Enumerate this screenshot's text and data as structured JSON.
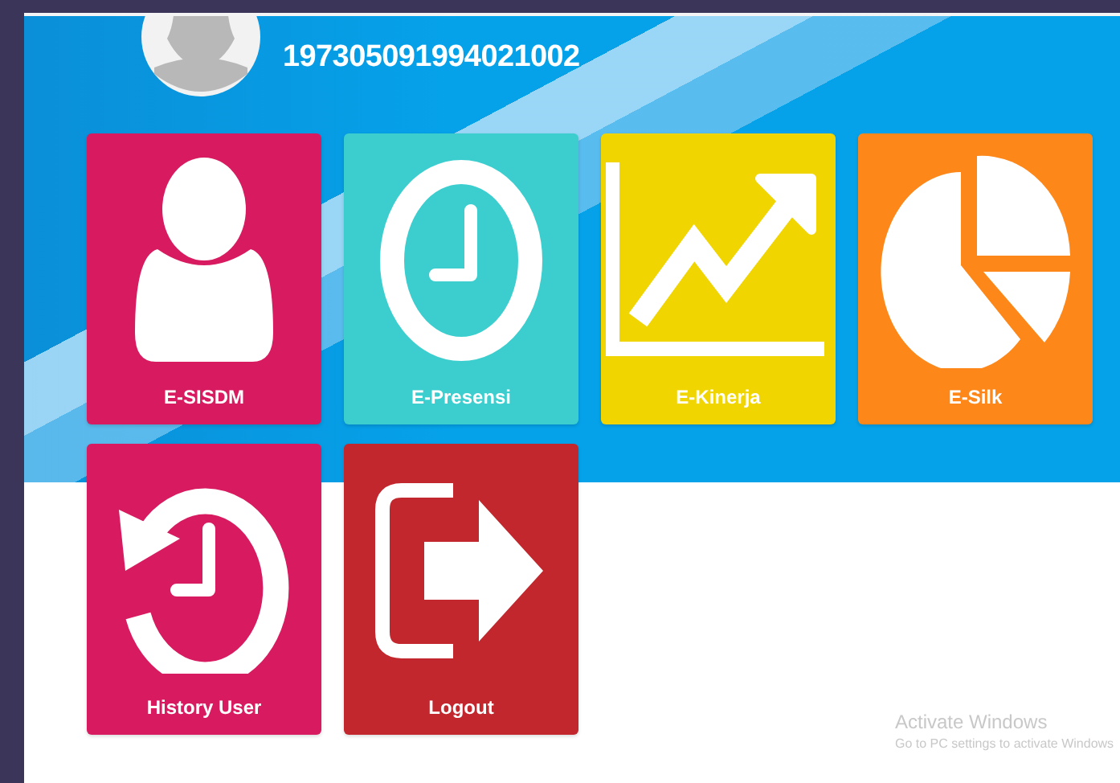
{
  "user": {
    "id": "197305091994021002"
  },
  "tiles": [
    {
      "label": "E-SISDM",
      "kind": "person",
      "color": "#d81b60"
    },
    {
      "label": "E-Presensi",
      "kind": "clock",
      "color": "#3ccece"
    },
    {
      "label": "E-Kinerja",
      "kind": "chart",
      "color": "#f0d500"
    },
    {
      "label": "E-Silk",
      "kind": "pie",
      "color": "#fd8819"
    },
    {
      "label": "History User",
      "kind": "history",
      "color": "#d81b60"
    },
    {
      "label": "Logout",
      "kind": "logout",
      "color": "#c1272d"
    }
  ],
  "activation_notice": {
    "title": "Activate Windows",
    "text": "Go to PC settings to activate Windows"
  }
}
